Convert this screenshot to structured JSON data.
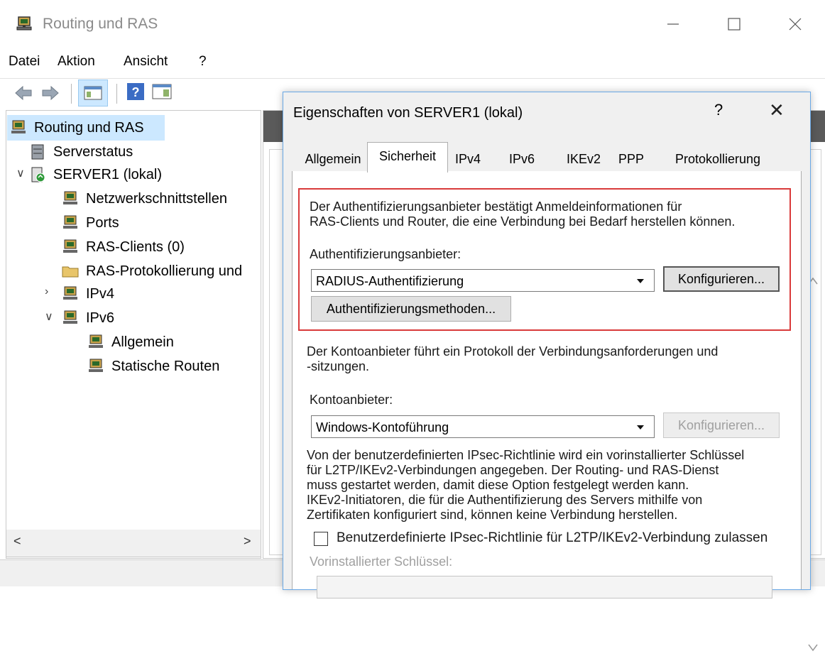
{
  "window": {
    "title": "Routing und RAS"
  },
  "menu": {
    "file": "Datei",
    "action": "Aktion",
    "view": "Ansicht",
    "help": "?"
  },
  "tree": {
    "root": "Routing und RAS",
    "serverstatus": "Serverstatus",
    "server": "SERVER1 (lokal)",
    "items": [
      "Netzwerkschnittstellen",
      "Ports",
      "RAS-Clients (0)",
      "RAS-Protokollierung und"
    ],
    "ipv4": "IPv4",
    "ipv6": "IPv6",
    "ipv6_children": [
      "Allgemein",
      "Statische Routen"
    ]
  },
  "dialog": {
    "title": "Eigenschaften von SERVER1 (lokal)",
    "help": "?",
    "close": "✕",
    "tabs": [
      "Allgemein",
      "Sicherheit",
      "IPv4",
      "IPv6",
      "IKEv2",
      "PPP",
      "Protokollierung"
    ],
    "active_tab": "Sicherheit",
    "auth_desc_1": "Der Authentifizierungsanbieter bestätigt Anmeldeinformationen für",
    "auth_desc_2": "RAS-Clients und Router, die eine Verbindung bei Bedarf herstellen können.",
    "auth_label": "Authentifizierungsanbieter:",
    "auth_value": "RADIUS-Authentifizierung",
    "configure_btn": "Konfigurieren...",
    "auth_methods_btn": "Authentifizierungsmethoden...",
    "acct_desc_1": "Der Kontoanbieter führt ein Protokoll der Verbindungsanforderungen und",
    "acct_desc_2": "-sitzungen.",
    "acct_label": "Kontoanbieter:",
    "acct_value": "Windows-Kontoführung",
    "acct_configure_btn": "Konfigurieren...",
    "ipsec_desc": [
      "Von der benutzerdefinierten IPsec-Richtlinie wird ein vorinstallierter Schlüssel",
      "für L2TP/IKEv2-Verbindungen angegeben. Der Routing- und RAS-Dienst",
      "muss gestartet werden, damit diese Option festgelegt werden kann.",
      "IKEv2-Initiatoren, die für die Authentifizierung des Servers mithilfe von",
      "Zertifikaten konfiguriert sind, können keine Verbindung herstellen."
    ],
    "ipsec_checkbox": "Benutzerdefinierte IPsec-Richtlinie für L2TP/IKEv2-Verbindung zulassen",
    "preshared_label": "Vorinstallierter Schlüssel:"
  },
  "colors": {
    "highlight": "#d93a3a",
    "selection": "#cce8ff",
    "dialog_border": "#69a8e6"
  }
}
